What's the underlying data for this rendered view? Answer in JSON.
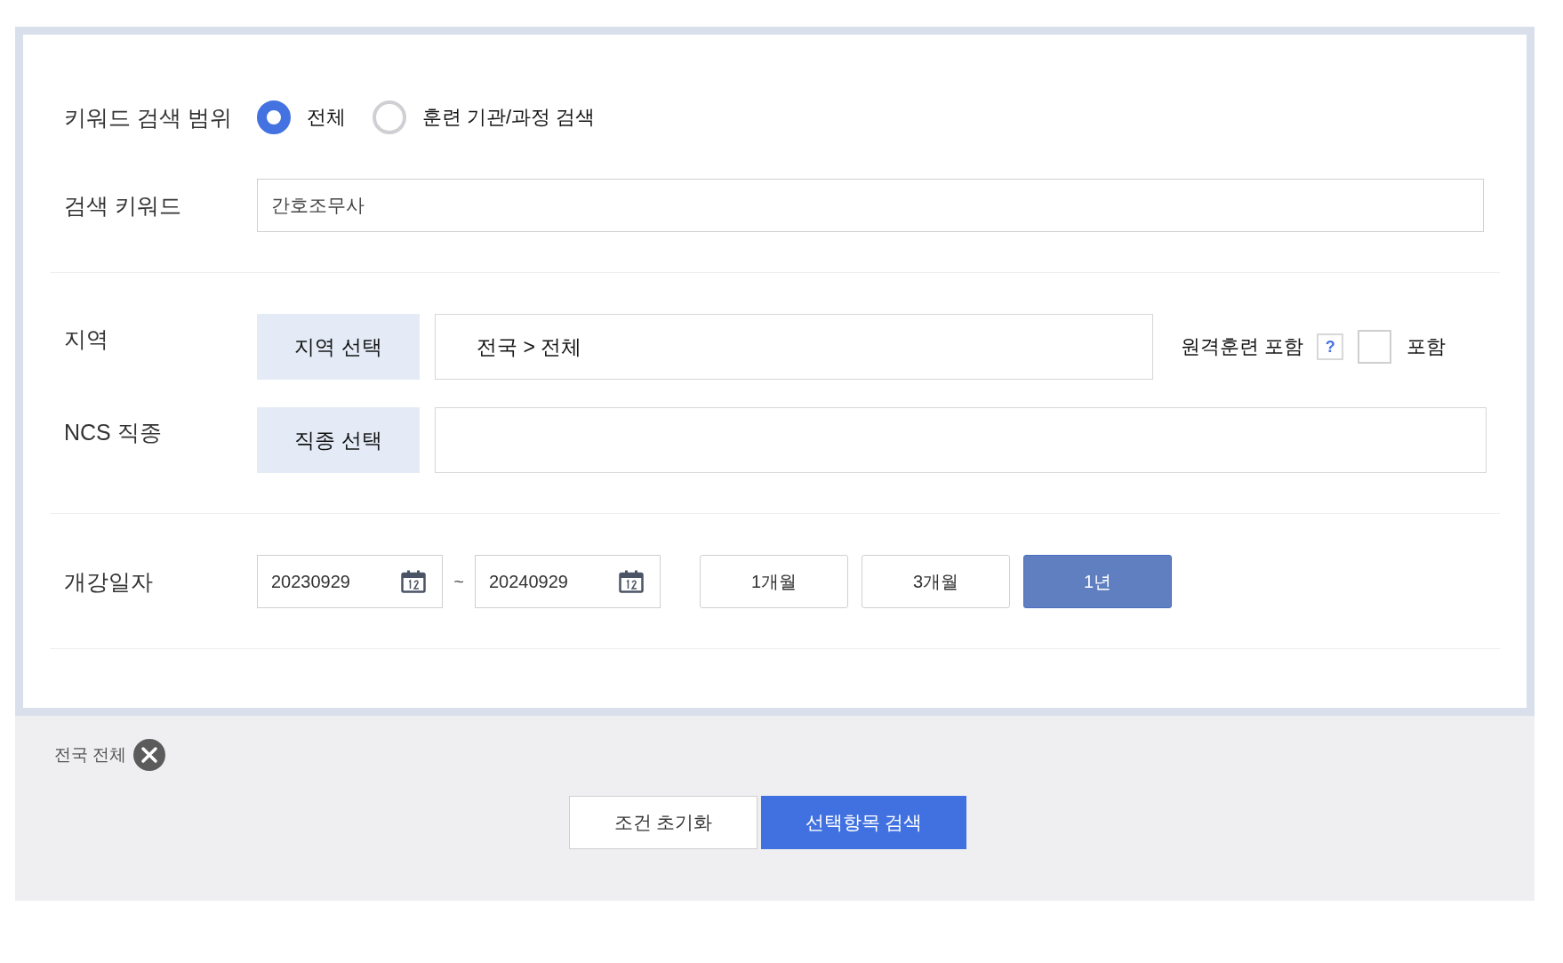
{
  "keyword_scope": {
    "label": "키워드 검색 범위",
    "options": [
      {
        "label": "전체",
        "selected": true
      },
      {
        "label": "훈련 기관/과정 검색",
        "selected": false
      }
    ]
  },
  "keyword": {
    "label": "검색 키워드",
    "value": "간호조무사"
  },
  "region": {
    "label": "지역",
    "button": "지역 선택",
    "value": "전국 > 전체",
    "remote": {
      "label": "원격훈련 포함",
      "help": "?",
      "checked": false,
      "checkbox_label": "포함"
    }
  },
  "ncs": {
    "label": "NCS 직종",
    "button": "직종 선택"
  },
  "start_date": {
    "label": "개강일자",
    "from": "20230929",
    "separator": "~",
    "to": "20240929",
    "periods": [
      {
        "label": "1개월",
        "selected": false
      },
      {
        "label": "3개월",
        "selected": false
      },
      {
        "label": "1년",
        "selected": true
      }
    ]
  },
  "tags": [
    {
      "label": "전국 전체"
    }
  ],
  "actions": [
    {
      "label": "조건 초기화",
      "kind": "secondary"
    },
    {
      "label": "선택항목 검색",
      "kind": "primary"
    }
  ]
}
